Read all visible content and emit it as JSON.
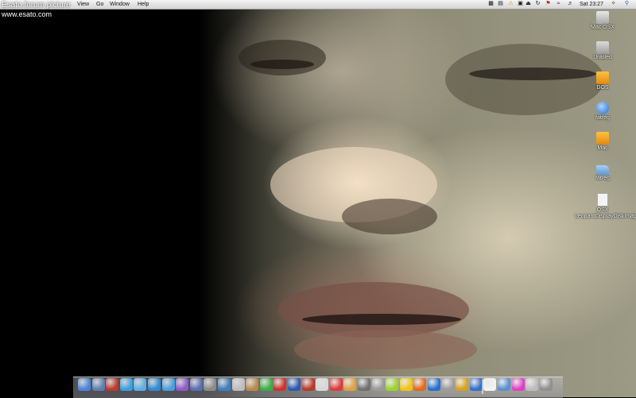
{
  "watermark": {
    "title": "Esato.forum picture",
    "url": "www.esato.com"
  },
  "menubar": {
    "items": [
      "View",
      "Go",
      "Window",
      "Help"
    ],
    "clock": "Sat 23:27"
  },
  "desktop_icons": [
    {
      "label": "Mac OSX",
      "icon": "hard-drive-icon",
      "color": "#c9c9c9"
    },
    {
      "label": "Untitled",
      "icon": "hard-drive-icon",
      "color": "#bdbdbd"
    },
    {
      "label": "DOS",
      "icon": "orange-drive-icon",
      "color": "#f0a020"
    },
    {
      "label": "fatreg",
      "icon": "network-globe-icon",
      "color": "#3b82d6"
    },
    {
      "label": "Mac",
      "icon": "orange-drive-icon",
      "color": "#f0a020"
    },
    {
      "label": "fatreg",
      "icon": "folder-icon",
      "color": "#7fb2e6"
    },
    {
      "label": "OSX LeopardDisplayDiskImage",
      "icon": "disk-image-document-icon",
      "color": "#eeeeee"
    }
  ],
  "dock_icons": [
    {
      "name": "finder-icon",
      "color": "#4a86d8"
    },
    {
      "name": "preview-icon",
      "color": "#5d7fb3"
    },
    {
      "name": "pdf-icon",
      "color": "#c0392b"
    },
    {
      "name": "messenger-icon",
      "color": "#3aa0e0"
    },
    {
      "name": "ichat-icon",
      "color": "#5aaee8"
    },
    {
      "name": "safari-icon",
      "color": "#2f8bd6"
    },
    {
      "name": "itunes-icon",
      "color": "#4a9fe0"
    },
    {
      "name": "purple-app-icon",
      "color": "#8e5cc9"
    },
    {
      "name": "books-icon",
      "color": "#5b6fb0"
    },
    {
      "name": "script-icon",
      "color": "#8a8a8a"
    },
    {
      "name": "network-icon",
      "color": "#3f7fc0"
    },
    {
      "name": "text-file-icon",
      "color": "#bdbdbd"
    },
    {
      "name": "address-book-icon",
      "color": "#b98a4a"
    },
    {
      "name": "green-circle-icon",
      "color": "#3cae45"
    },
    {
      "name": "magnet-icon",
      "color": "#d03030"
    },
    {
      "name": "arrow-icon",
      "color": "#2c59b0"
    },
    {
      "name": "red-app-icon",
      "color": "#b83a2a"
    },
    {
      "name": "mail-icon",
      "color": "#d7d7d7"
    },
    {
      "name": "fire-extinguisher-icon",
      "color": "#e03a3a"
    },
    {
      "name": "people-icon",
      "color": "#e0a040"
    },
    {
      "name": "utility-icon",
      "color": "#707070"
    },
    {
      "name": "camera-icon",
      "color": "#9a9a9a"
    },
    {
      "name": "lime-icon",
      "color": "#9ad32e"
    },
    {
      "name": "road-sign-icon",
      "color": "#f1c40f"
    },
    {
      "name": "firefox-icon",
      "color": "#e06a20"
    },
    {
      "name": "sync-icon",
      "color": "#2a6fd0"
    },
    {
      "name": "time-machine-icon",
      "color": "#9c9c9c"
    },
    {
      "name": "transmit-icon",
      "color": "#d8a020"
    },
    {
      "name": "bird-icon",
      "color": "#3470c8"
    },
    {
      "name": "document-icon",
      "color": "#f2f2f2"
    },
    {
      "name": "monitor-icon",
      "color": "#5a8fd0"
    },
    {
      "name": "pink-app-icon",
      "color": "#e040c8"
    },
    {
      "name": "system-prefs-icon",
      "color": "#bcbcbc"
    },
    {
      "name": "trash-icon",
      "color": "#909090"
    }
  ]
}
